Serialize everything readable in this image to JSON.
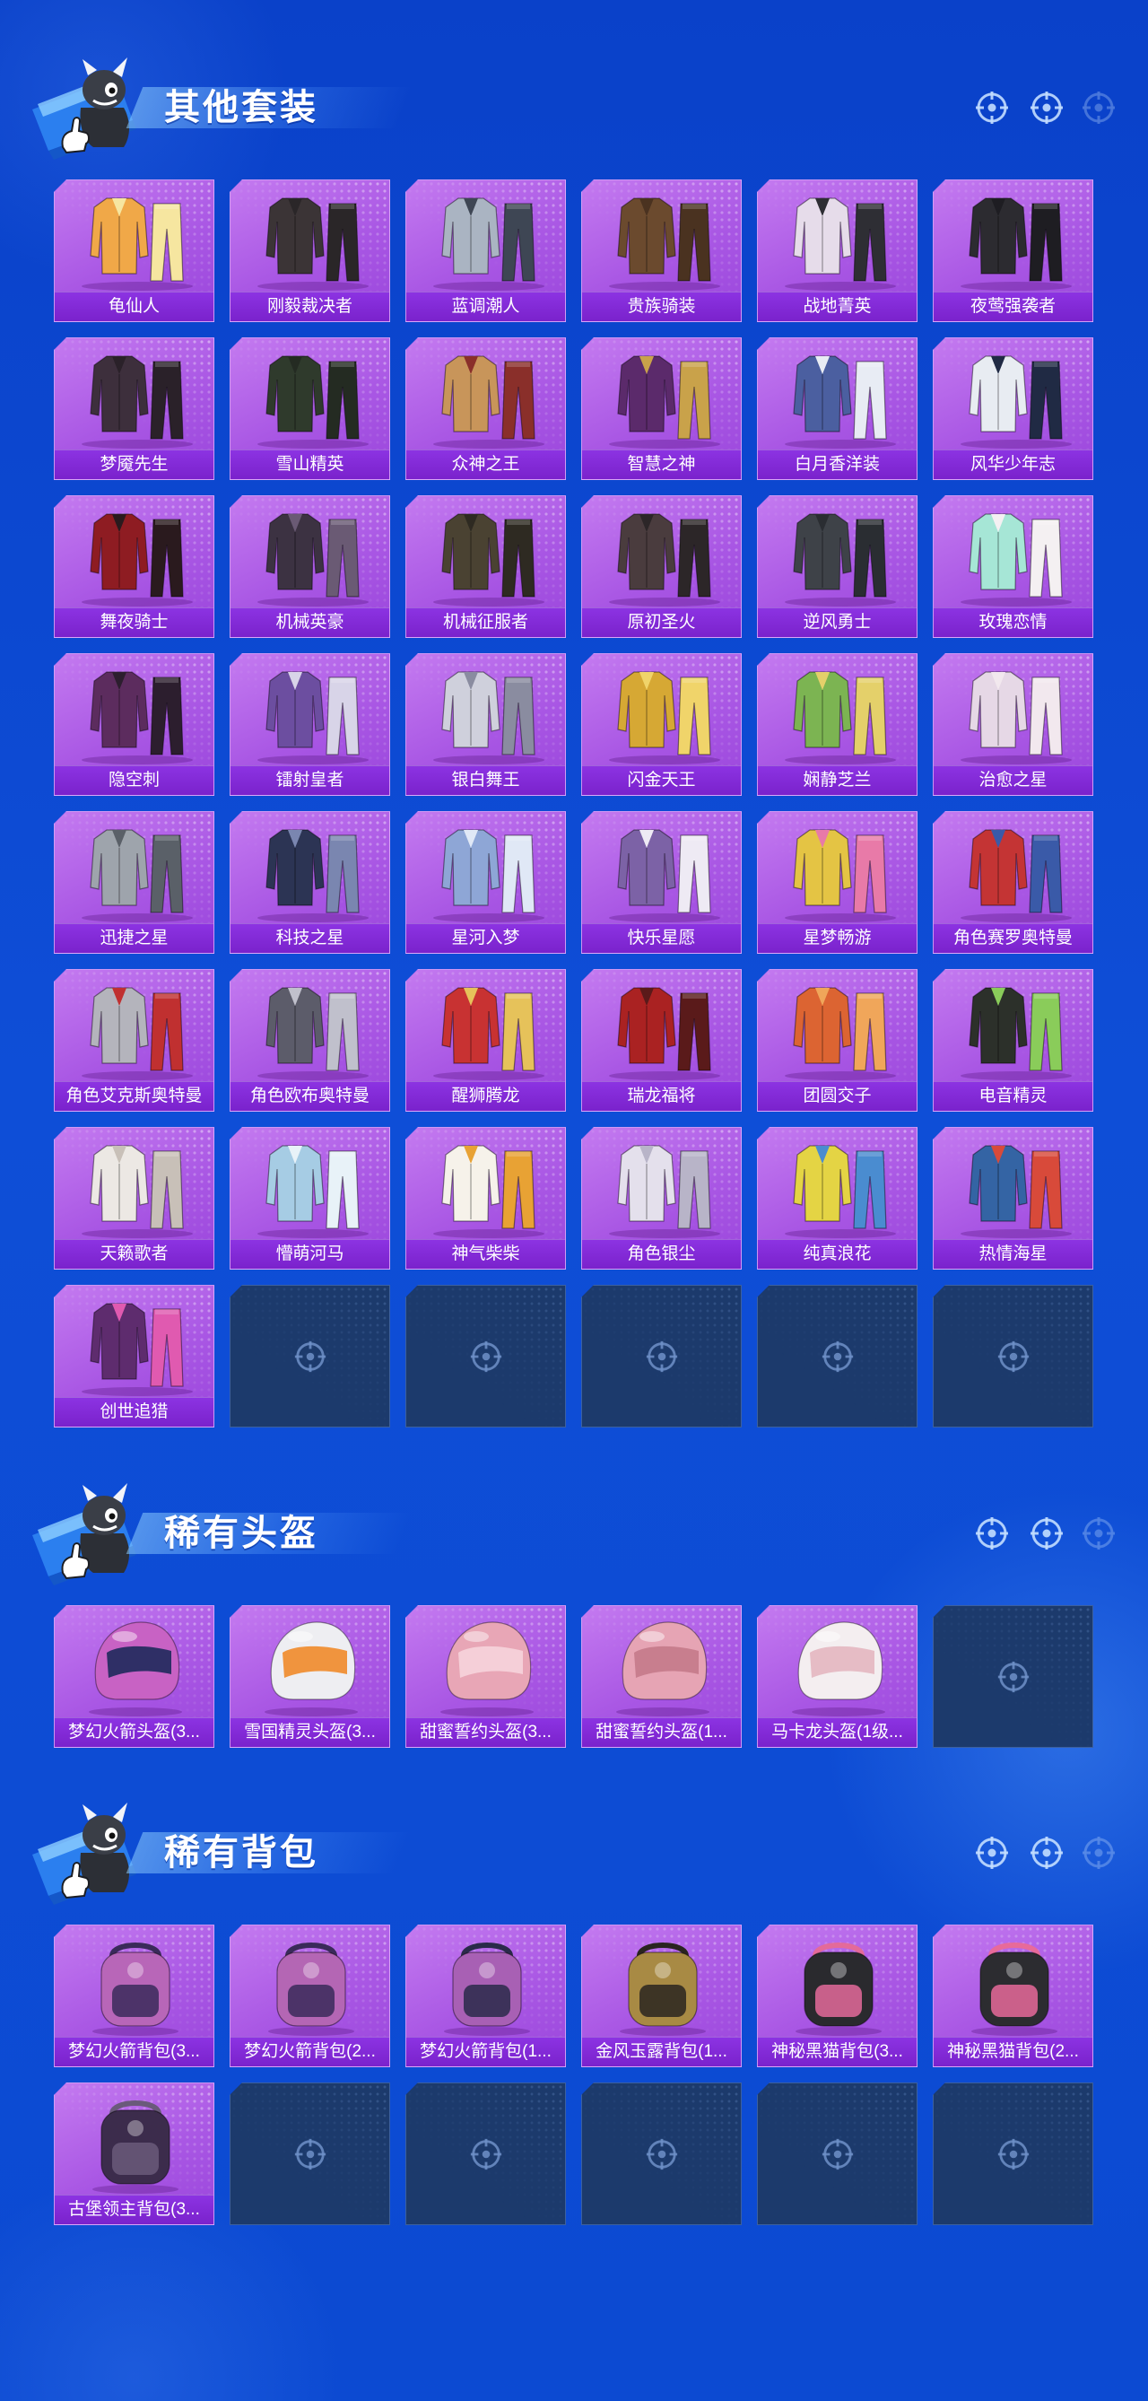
{
  "theme": {
    "bg_top": "#0a41c9",
    "bg_mid": "#0e4ed7",
    "bg_bottom": "#0c4ad2",
    "card": "#a957e4",
    "card_light": "#c47af0",
    "label": "#7a22cc",
    "empty_slot": "#1c3a6c"
  },
  "sections": [
    {
      "title": "其他套装",
      "type": "outfit",
      "empty_slots": 5,
      "items": [
        {
          "label": "龟仙人",
          "colors": [
            "#f0a848",
            "#f6e6a0"
          ]
        },
        {
          "label": "刚毅裁决者",
          "colors": [
            "#3b3436",
            "#2a2628"
          ]
        },
        {
          "label": "蓝调潮人",
          "colors": [
            "#aab4c2",
            "#3e4654"
          ]
        },
        {
          "label": "贵族骑装",
          "colors": [
            "#6b4a2e",
            "#4a3220"
          ]
        },
        {
          "label": "战地菁英",
          "colors": [
            "#e6dcea",
            "#2e2e34"
          ]
        },
        {
          "label": "夜莺强袭者",
          "colors": [
            "#2c2b30",
            "#1e1d22"
          ]
        },
        {
          "label": "梦魇先生",
          "colors": [
            "#3d2f3c",
            "#2a2129"
          ]
        },
        {
          "label": "雪山精英",
          "colors": [
            "#2f3a2c",
            "#242b22"
          ]
        },
        {
          "label": "众神之王",
          "colors": [
            "#c8955a",
            "#8a2f2a"
          ]
        },
        {
          "label": "智慧之神",
          "colors": [
            "#5b2a6b",
            "#c9a24a"
          ]
        },
        {
          "label": "白月香洋装",
          "colors": [
            "#4b5fa0",
            "#e8ecf4"
          ]
        },
        {
          "label": "风华少年志",
          "colors": [
            "#e8ecf2",
            "#202a44"
          ]
        },
        {
          "label": "舞夜骑士",
          "colors": [
            "#8e1c22",
            "#2a1a1e"
          ]
        },
        {
          "label": "机械英豪",
          "colors": [
            "#3c3242",
            "#6a5a74"
          ]
        },
        {
          "label": "机械征服者",
          "colors": [
            "#4a4232",
            "#2e2a22"
          ]
        },
        {
          "label": "原初圣火",
          "colors": [
            "#4a3c3e",
            "#2c2628"
          ]
        },
        {
          "label": "逆风勇士",
          "colors": [
            "#3e4248",
            "#2a2d32"
          ]
        },
        {
          "label": "玫瑰恋情",
          "colors": [
            "#a6e6d6",
            "#f4f0f2"
          ]
        },
        {
          "label": "隐空刺",
          "colors": [
            "#5c2c5e",
            "#2c1e2e"
          ]
        },
        {
          "label": "镭射皇者",
          "colors": [
            "#6c4ea0",
            "#d8d4e8"
          ]
        },
        {
          "label": "银白舞王",
          "colors": [
            "#cfd0dc",
            "#8a8ca0"
          ]
        },
        {
          "label": "闪金天王",
          "colors": [
            "#d6a834",
            "#f0d46a"
          ]
        },
        {
          "label": "娴静芝兰",
          "colors": [
            "#7cb452",
            "#e4d06a"
          ]
        },
        {
          "label": "治愈之星",
          "colors": [
            "#e6d8e6",
            "#f2e8ee"
          ]
        },
        {
          "label": "迅捷之星",
          "colors": [
            "#9ea4ac",
            "#5a6068"
          ]
        },
        {
          "label": "科技之星",
          "colors": [
            "#2c3454",
            "#7a86b0"
          ]
        },
        {
          "label": "星河入梦",
          "colors": [
            "#8ea6d6",
            "#e0e8f6"
          ]
        },
        {
          "label": "快乐星愿",
          "colors": [
            "#7c62a6",
            "#eeeaf4"
          ]
        },
        {
          "label": "星梦畅游",
          "colors": [
            "#e4c444",
            "#e87aa8"
          ]
        },
        {
          "label": "角色赛罗奥特曼",
          "colors": [
            "#c43434",
            "#3a5aa8"
          ]
        },
        {
          "label": "角色艾克斯奥特曼",
          "colors": [
            "#b4b4bc",
            "#c03030"
          ]
        },
        {
          "label": "角色欧布奥特曼",
          "colors": [
            "#5c5c6a",
            "#c0c0cc"
          ]
        },
        {
          "label": "醒狮腾龙",
          "colors": [
            "#c83232",
            "#e6c25a"
          ]
        },
        {
          "label": "瑞龙福将",
          "colors": [
            "#aa2222",
            "#5a1a1a"
          ]
        },
        {
          "label": "团圆交子",
          "colors": [
            "#dc6432",
            "#f0a65a"
          ]
        },
        {
          "label": "电音精灵",
          "colors": [
            "#2c302a",
            "#8acc5a"
          ]
        },
        {
          "label": "天籁歌者",
          "colors": [
            "#ece8e4",
            "#c8c0b8"
          ]
        },
        {
          "label": "懵萌河马",
          "colors": [
            "#a6cce4",
            "#e8f2f8"
          ]
        },
        {
          "label": "神气柴柴",
          "colors": [
            "#f6f2ea",
            "#e8a234"
          ]
        },
        {
          "label": "角色银尘",
          "colors": [
            "#e4e0ec",
            "#b8b4c8"
          ]
        },
        {
          "label": "纯真浪花",
          "colors": [
            "#e4d444",
            "#4a8cd0"
          ]
        },
        {
          "label": "热情海星",
          "colors": [
            "#3464a4",
            "#d84a3a"
          ]
        },
        {
          "label": "创世追猎",
          "colors": [
            "#5e2c6e",
            "#e05ab0"
          ]
        }
      ]
    },
    {
      "title": "稀有头盔",
      "type": "helmet",
      "empty_slots": 1,
      "items": [
        {
          "label": "梦幻火箭头盔(3...",
          "colors": [
            "#c862c4",
            "#1e2a5c"
          ]
        },
        {
          "label": "雪国精灵头盔(3...",
          "colors": [
            "#eeeef2",
            "#f08a2a"
          ]
        },
        {
          "label": "甜蜜誓约头盔(3...",
          "colors": [
            "#e8a6b6",
            "#f6d4dc"
          ]
        },
        {
          "label": "甜蜜誓约头盔(1...",
          "colors": [
            "#e6a4b4",
            "#c47a8a"
          ]
        },
        {
          "label": "马卡龙头盔(1级...",
          "colors": [
            "#f4eef0",
            "#e4b6c0"
          ]
        }
      ]
    },
    {
      "title": "稀有背包",
      "type": "backpack",
      "empty_slots": 5,
      "items": [
        {
          "label": "梦幻火箭背包(3...",
          "colors": [
            "#b866b8",
            "#3a2a5a"
          ]
        },
        {
          "label": "梦幻火箭背包(2...",
          "colors": [
            "#b466b4",
            "#3a2a5a"
          ]
        },
        {
          "label": "梦幻火箭背包(1...",
          "colors": [
            "#a860b4",
            "#2a2a4a"
          ]
        },
        {
          "label": "金风玉露背包(1...",
          "colors": [
            "#a88a44",
            "#2a2420"
          ]
        },
        {
          "label": "神秘黑猫背包(3...",
          "colors": [
            "#2a2a2e",
            "#e46a9a"
          ]
        },
        {
          "label": "神秘黑猫背包(2...",
          "colors": [
            "#2c2c30",
            "#e86a9a"
          ]
        },
        {
          "label": "古堡领主背包(3...",
          "colors": [
            "#3c2c4c",
            "#6a5a7a"
          ]
        }
      ]
    }
  ]
}
